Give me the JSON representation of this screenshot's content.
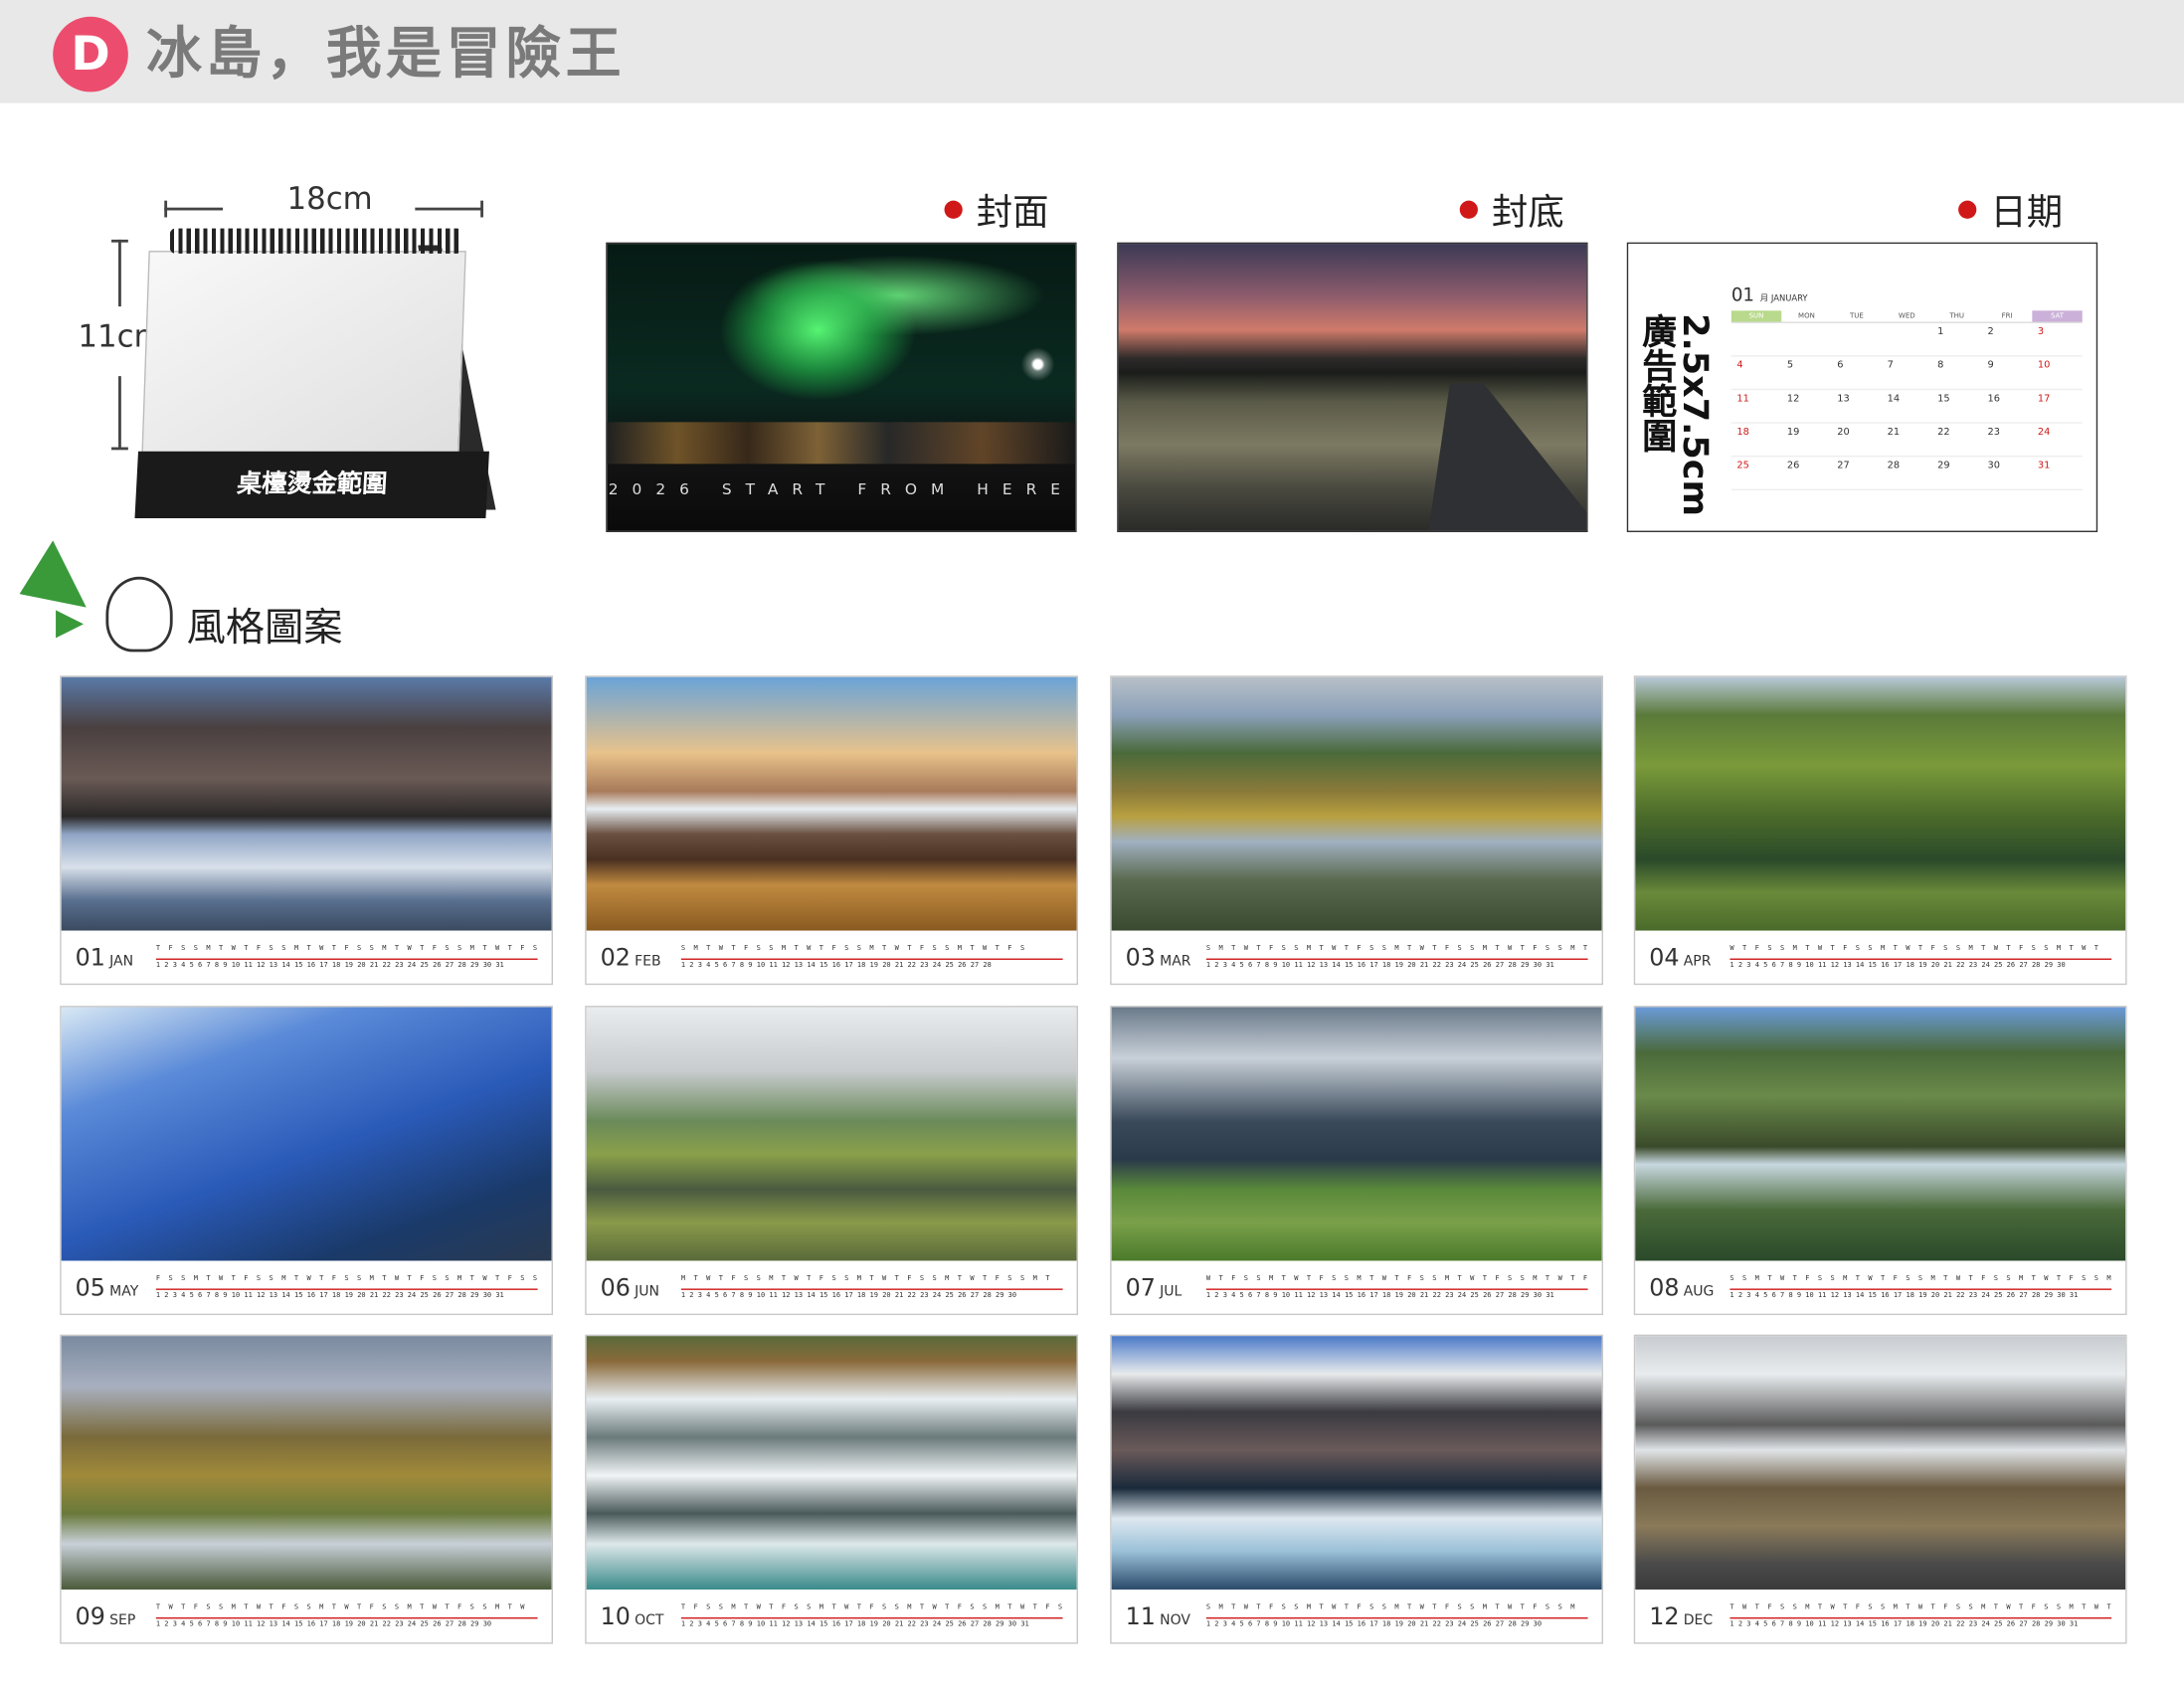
{
  "header": {
    "badge": "D",
    "title": "冰島，我是冒險王"
  },
  "product": {
    "width_label": "18cm",
    "height_label": "11cm",
    "band_label": "桌檯燙金範圍"
  },
  "previews": {
    "cover_label": "封面",
    "back_label": "封底",
    "date_label": "日期",
    "cover_text": "2026  START  FROM  HERE",
    "ad_label": "2.5x7.5cm廣告範圍",
    "mini_month": "01",
    "mini_month_name": "月 JANUARY",
    "mini_dows": [
      "SUN",
      "MON",
      "TUE",
      "WED",
      "THU",
      "FRI",
      "SAT"
    ],
    "mini_days": [
      "",
      "",
      "",
      "",
      "1",
      "2",
      "3",
      "4",
      "5",
      "6",
      "7",
      "8",
      "9",
      "10",
      "11",
      "12",
      "13",
      "14",
      "15",
      "16",
      "17",
      "18",
      "19",
      "20",
      "21",
      "22",
      "23",
      "24",
      "25",
      "26",
      "27",
      "28",
      "29",
      "30",
      "31"
    ]
  },
  "style_section": {
    "label": "風格圖案"
  },
  "months": [
    {
      "num": "01",
      "abbr": "JAN",
      "dows": "T F S S M T W T F S S M T W T F S S M T W T F S S M T W T F S",
      "nums": "1 2 3 4 5 6 7 8 9 10 11 12 13 14 15 16 17 18 19 20 21 22 23 24 25 26 27 28 29 30 31"
    },
    {
      "num": "02",
      "abbr": "FEB",
      "dows": "S M T W T F S S M T W T F S S M T W T F S S M T W T F S",
      "nums": "1 2 3 4 5 6 7 8 9 10 11 12 13 14 15 16 17 18 19 20 21 22 23 24 25 26 27 28"
    },
    {
      "num": "03",
      "abbr": "MAR",
      "dows": "S M T W T F S S M T W T F S S M T W T F S S M T W T F S S M T",
      "nums": "1 2 3 4 5 6 7 8 9 10 11 12 13 14 15 16 17 18 19 20 21 22 23 24 25 26 27 28 29 30 31"
    },
    {
      "num": "04",
      "abbr": "APR",
      "dows": "W T F S S M T W T F S S M T W T F S S M T W T F S S M T W T",
      "nums": "1 2 3 4 5 6 7 8 9 10 11 12 13 14 15 16 17 18 19 20 21 22 23 24 25 26 27 28 29 30"
    },
    {
      "num": "05",
      "abbr": "MAY",
      "dows": "F S S M T W T F S S M T W T F S S M T W T F S S M T W T F S S",
      "nums": "1 2 3 4 5 6 7 8 9 10 11 12 13 14 15 16 17 18 19 20 21 22 23 24 25 26 27 28 29 30 31"
    },
    {
      "num": "06",
      "abbr": "JUN",
      "dows": "M T W T F S S M T W T F S S M T W T F S S M T W T F S S M T",
      "nums": "1 2 3 4 5 6 7 8 9 10 11 12 13 14 15 16 17 18 19 20 21 22 23 24 25 26 27 28 29 30"
    },
    {
      "num": "07",
      "abbr": "JUL",
      "dows": "W T F S S M T W T F S S M T W T F S S M T W T F S S M T W T F",
      "nums": "1 2 3 4 5 6 7 8 9 10 11 12 13 14 15 16 17 18 19 20 21 22 23 24 25 26 27 28 29 30 31"
    },
    {
      "num": "08",
      "abbr": "AUG",
      "dows": "S S M T W T F S S M T W T F S S M T W T F S S M T W T F S S M",
      "nums": "1 2 3 4 5 6 7 8 9 10 11 12 13 14 15 16 17 18 19 20 21 22 23 24 25 26 27 28 29 30 31"
    },
    {
      "num": "09",
      "abbr": "SEP",
      "dows": "T W T F S S M T W T F S S M T W T F S S M T W T F S S M T W",
      "nums": "1 2 3 4 5 6 7 8 9 10 11 12 13 14 15 16 17 18 19 20 21 22 23 24 25 26 27 28 29 30"
    },
    {
      "num": "10",
      "abbr": "OCT",
      "dows": "T F S S M T W T F S S M T W T F S S M T W T F S S M T W T F S",
      "nums": "1 2 3 4 5 6 7 8 9 10 11 12 13 14 15 16 17 18 19 20 21 22 23 24 25 26 27 28 29 30 31"
    },
    {
      "num": "11",
      "abbr": "NOV",
      "dows": "S M T W T F S S M T W T F S S M T W T F S S M T W T F S S M",
      "nums": "1 2 3 4 5 6 7 8 9 10 11 12 13 14 15 16 17 18 19 20 21 22 23 24 25 26 27 28 29 30"
    },
    {
      "num": "12",
      "abbr": "DEC",
      "dows": "T W T F S S M T W T F S S M T W T F S S M T W T F S S M T W T",
      "nums": "1 2 3 4 5 6 7 8 9 10 11 12 13 14 15 16 17 18 19 20 21 22 23 24 25 26 27 28 29 30 31"
    }
  ]
}
